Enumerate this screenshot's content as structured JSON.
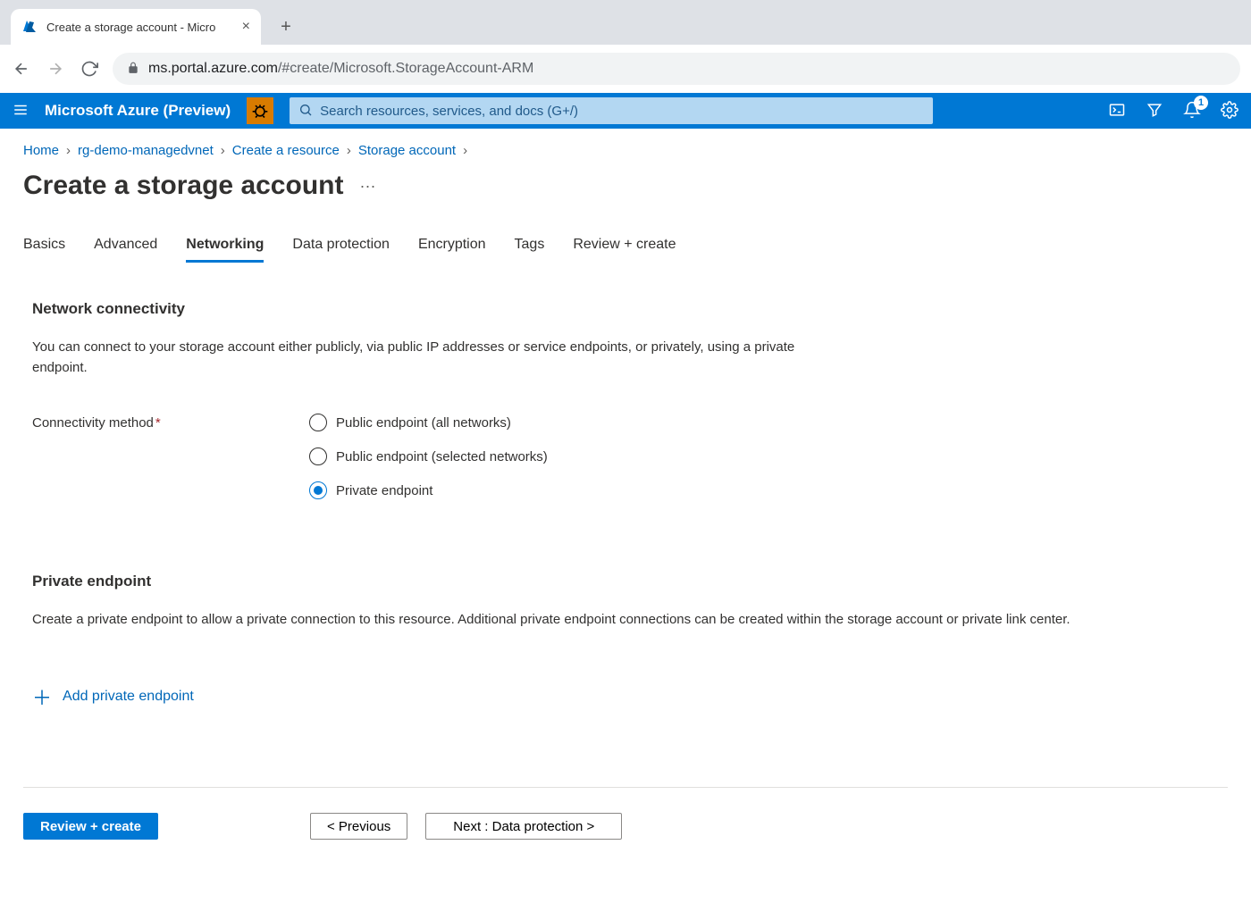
{
  "browser": {
    "tab_title": "Create a storage account - Micro",
    "url_domain": "ms.portal.azure.com",
    "url_path": "/#create/Microsoft.StorageAccount-ARM"
  },
  "topbar": {
    "brand": "Microsoft Azure (Preview)",
    "search_placeholder": "Search resources, services, and docs (G+/)",
    "notification_count": "1"
  },
  "breadcrumb": [
    "Home",
    "rg-demo-managedvnet",
    "Create a resource",
    "Storage account"
  ],
  "page_title": "Create a storage account",
  "tabs": [
    "Basics",
    "Advanced",
    "Networking",
    "Data protection",
    "Encryption",
    "Tags",
    "Review + create"
  ],
  "active_tab": "Networking",
  "section1": {
    "title": "Network connectivity",
    "desc": "You can connect to your storage account either publicly, via public IP addresses or service endpoints, or privately, using a private endpoint.",
    "field_label": "Connectivity method",
    "options": [
      "Public endpoint (all networks)",
      "Public endpoint (selected networks)",
      "Private endpoint"
    ],
    "selected_option": 2
  },
  "section2": {
    "title": "Private endpoint",
    "desc": "Create a private endpoint to allow a private connection to this resource. Additional private endpoint connections can be created within the storage account or private link center.",
    "add_link": "Add private endpoint"
  },
  "footer": {
    "primary": "Review + create",
    "prev": "<  Previous",
    "next": "Next : Data protection  >"
  }
}
